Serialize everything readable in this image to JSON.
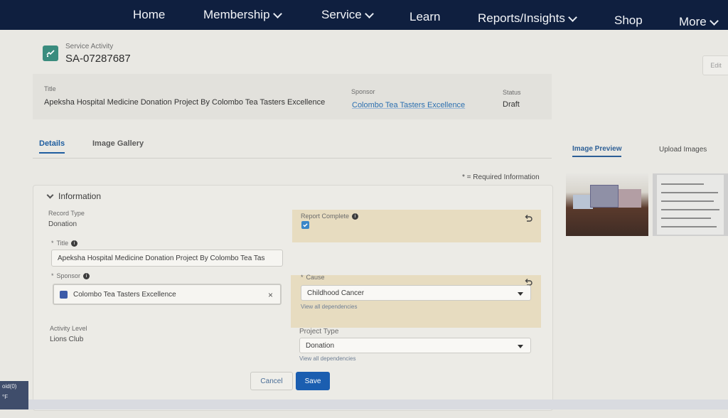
{
  "nav": {
    "items": [
      {
        "label": "Home",
        "dropdown": false
      },
      {
        "label": "Membership",
        "dropdown": true
      },
      {
        "label": "Service",
        "dropdown": true
      },
      {
        "label": "Learn",
        "dropdown": false
      },
      {
        "label": "Reports/Insights",
        "dropdown": true
      },
      {
        "label": "Shop",
        "dropdown": false
      },
      {
        "label": "More",
        "dropdown": true
      }
    ]
  },
  "record": {
    "type_label": "Service Activity",
    "id": "SA-07287687",
    "edit_label": "Edit",
    "icon": "service-activity-icon"
  },
  "highlights": {
    "title_label": "Title",
    "title_value": "Apeksha Hospital Medicine Donation Project By Colombo Tea Tasters Excellence",
    "sponsor_label": "Sponsor",
    "sponsor_value": "Colombo Tea Tasters Excellence",
    "status_label": "Status",
    "status_value": "Draft"
  },
  "tabs": {
    "details": "Details",
    "gallery": "Image Gallery"
  },
  "required_info": "* = Required Information",
  "section": {
    "title": "Information",
    "record_type_label": "Record Type",
    "record_type_value": "Donation",
    "report_complete_label": "Report Complete",
    "report_complete_checked": true,
    "title_label": "Title",
    "title_input": "Apeksha Hospital Medicine Donation Project By Colombo Tea Tas",
    "sponsor_label": "Sponsor",
    "sponsor_input": "Colombo Tea Tasters Excellence",
    "cause_label": "Cause",
    "cause_value": "Childhood Cancer",
    "view_deps": "View all dependencies",
    "activity_level_label": "Activity Level",
    "activity_level_value": "Lions Club",
    "project_type_label": "Project Type",
    "project_type_value": "Donation"
  },
  "buttons": {
    "cancel": "Cancel",
    "save": "Save"
  },
  "right_panel": {
    "tab_preview": "Image Preview",
    "tab_upload": "Upload Images"
  },
  "taskbar": {
    "left_top": "oid(0)",
    "left_bottom": "°F"
  }
}
